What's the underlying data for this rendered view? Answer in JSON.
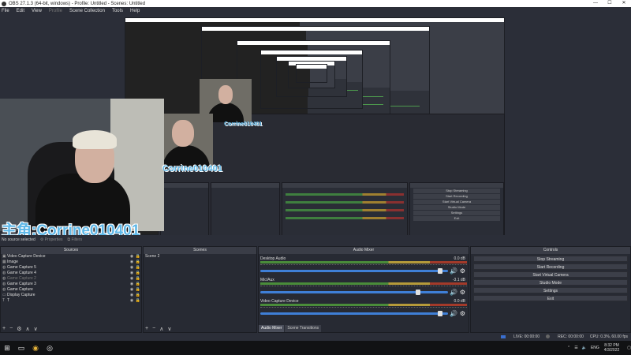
{
  "window": {
    "title": "OBS 27.1.3 (64-bit, windows) - Profile: Untitled - Scenes: Untitled",
    "min": "—",
    "max": "☐",
    "close": "✕"
  },
  "menu": [
    "File",
    "Edit",
    "View",
    "Profile",
    "Scene Collection",
    "Tools",
    "Help"
  ],
  "preview": {
    "overlay_text": "主角:Corrine010401",
    "overlay_text_small": "Corrine010401",
    "no_source": "No source selected",
    "properties": "Properties",
    "filters": "Filters",
    "inner_controls": [
      "Stop Streaming",
      "Start Recording",
      "Start Virtual Camera",
      "Studio Mode",
      "Settings",
      "Exit"
    ]
  },
  "sources": {
    "title": "Sources",
    "items": [
      {
        "label": "Video Capture Device",
        "icon": "camera-icon",
        "dim": false
      },
      {
        "label": "Image",
        "icon": "image-icon",
        "dim": false
      },
      {
        "label": "Game Capture 5",
        "icon": "gamepad-icon",
        "dim": false
      },
      {
        "label": "Game Capture 4",
        "icon": "gamepad-icon",
        "dim": false
      },
      {
        "label": "Game Capture 2",
        "icon": "gamepad-icon",
        "dim": true
      },
      {
        "label": "Game Capture 3",
        "icon": "gamepad-icon",
        "dim": false
      },
      {
        "label": "Game Capture",
        "icon": "gamepad-icon",
        "dim": false
      },
      {
        "label": "Display Capture",
        "icon": "monitor-icon",
        "dim": false
      },
      {
        "label": "T",
        "icon": "text-icon",
        "dim": false
      }
    ],
    "tools": [
      "+",
      "−",
      "⚙",
      "∧",
      "∨"
    ]
  },
  "scenes": {
    "title": "Scenes",
    "items": [
      {
        "label": "Scene 2"
      }
    ],
    "tools": [
      "+",
      "−",
      "∧",
      "∨"
    ]
  },
  "mixer": {
    "title": "Audio Mixer",
    "channels": [
      {
        "name": "Desktop Audio",
        "db": "0.0 dB",
        "level": 0.97
      },
      {
        "name": "Mic/Aux",
        "db": "-3.1 dB",
        "level": 0.85
      },
      {
        "name": "Video Capture Device",
        "db": "0.0 dB",
        "level": 0.97
      }
    ],
    "tabs": [
      "Audio Mixer",
      "Scene Transitions"
    ]
  },
  "controls": {
    "title": "Controls",
    "buttons": [
      "Stop Streaming",
      "Start Recording",
      "Start Virtual Camera",
      "Studio Mode",
      "Settings",
      "Exit"
    ]
  },
  "status": {
    "live": "LIVE: 00:00:00",
    "rec": "REC: 00:00:00",
    "cpu": "CPU: 0.3%, 60.00 fps"
  },
  "taskbar": {
    "lang": "ENG",
    "time": "8:32 PM",
    "date": "4/3/2022"
  }
}
